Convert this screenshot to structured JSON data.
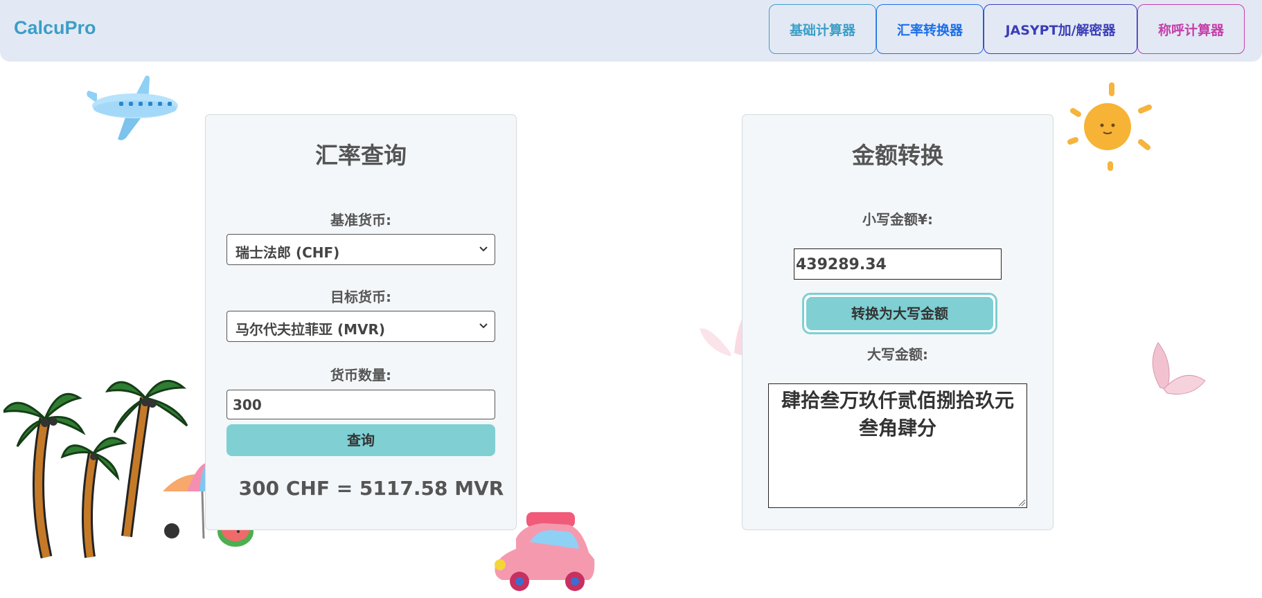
{
  "brand": "CalcuPro",
  "nav": [
    {
      "label": "基础计算器"
    },
    {
      "label": "汇率转换器"
    },
    {
      "label": "JASYPT加/解密器"
    },
    {
      "label": "称呼计算器"
    }
  ],
  "exchange": {
    "title": "汇率查询",
    "base_label": "基准货币:",
    "base_value": "瑞士法郎 (CHF)",
    "target_label": "目标货币:",
    "target_value": "马尔代夫拉菲亚 (MVR)",
    "amount_label": "货币数量:",
    "amount_value": "300",
    "query_button": "查询",
    "result": "300 CHF = 5117.58 MVR"
  },
  "converter": {
    "title": "金额转换",
    "small_label": "小写金额¥:",
    "small_value": "439289.34",
    "convert_button": "转换为大写金额",
    "big_label": "大写金额:",
    "big_value": "肆拾叁万玖仟贰佰捌拾玖元叁角肆分"
  },
  "colors": {
    "accent": "#7fcfd3",
    "nav_bg": "#e3e9f4",
    "brand": "#3a9ec7"
  },
  "icons": [
    "airplane-icon",
    "sun-icon",
    "palm-trees-icon",
    "beach-umbrella-icon",
    "watermelon-icon",
    "car-icon",
    "butterfly-icon",
    "chevron-down-icon"
  ]
}
